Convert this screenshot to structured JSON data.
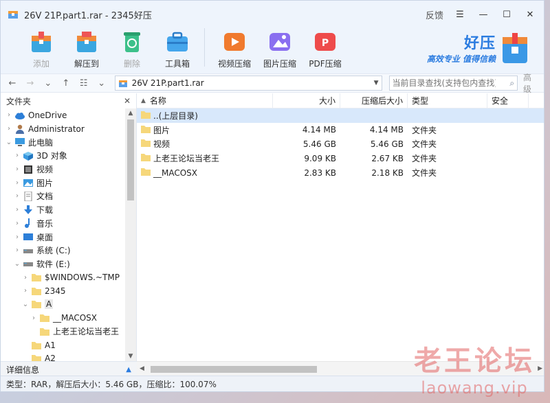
{
  "window": {
    "title": "26V 21P.part1.rar - 2345好压",
    "feedback": "反馈"
  },
  "toolbar": {
    "buttons": [
      {
        "label": "添加",
        "icon": "add-archive-icon",
        "enabled": false
      },
      {
        "label": "解压到",
        "icon": "extract-icon",
        "enabled": true
      },
      {
        "label": "删除",
        "icon": "recycle-icon",
        "enabled": false
      },
      {
        "label": "工具箱",
        "icon": "toolbox-icon",
        "enabled": true
      },
      {
        "label": "视频压缩",
        "icon": "video-compress-icon",
        "enabled": true
      },
      {
        "label": "图片压缩",
        "icon": "image-compress-icon",
        "enabled": true
      },
      {
        "label": "PDF压缩",
        "icon": "pdf-compress-icon",
        "enabled": true
      }
    ],
    "brand": {
      "name": "好压",
      "slogan": "高效专业 值得信赖"
    }
  },
  "addressbar": {
    "path": "26V 21P.part1.rar",
    "search_placeholder": "当前目录查找(支持包内查找)",
    "advanced": "高级"
  },
  "tree": {
    "header": "文件夹",
    "items": [
      {
        "label": "OneDrive",
        "depth": 0,
        "arrow": "›",
        "icon": "cloud-icon"
      },
      {
        "label": "Administrator",
        "depth": 0,
        "arrow": "›",
        "icon": "user-icon"
      },
      {
        "label": "此电脑",
        "depth": 0,
        "arrow": "⌄",
        "icon": "computer-icon"
      },
      {
        "label": "3D 对象",
        "depth": 1,
        "arrow": "›",
        "icon": "cube-icon"
      },
      {
        "label": "视频",
        "depth": 1,
        "arrow": "›",
        "icon": "video-folder-icon"
      },
      {
        "label": "图片",
        "depth": 1,
        "arrow": "›",
        "icon": "picture-folder-icon"
      },
      {
        "label": "文档",
        "depth": 1,
        "arrow": "›",
        "icon": "document-folder-icon"
      },
      {
        "label": "下载",
        "depth": 1,
        "arrow": "›",
        "icon": "download-icon"
      },
      {
        "label": "音乐",
        "depth": 1,
        "arrow": "›",
        "icon": "music-icon"
      },
      {
        "label": "桌面",
        "depth": 1,
        "arrow": "›",
        "icon": "desktop-icon"
      },
      {
        "label": "系统 (C:)",
        "depth": 1,
        "arrow": "›",
        "icon": "drive-icon"
      },
      {
        "label": "软件 (E:)",
        "depth": 1,
        "arrow": "⌄",
        "icon": "drive-icon"
      },
      {
        "label": "$WINDOWS.~TMP",
        "depth": 2,
        "arrow": "›",
        "icon": "folder-icon"
      },
      {
        "label": "2345",
        "depth": 2,
        "arrow": "›",
        "icon": "folder-icon"
      },
      {
        "label": "A",
        "depth": 2,
        "arrow": "⌄",
        "icon": "folder-icon",
        "selected": true
      },
      {
        "label": "__MACOSX",
        "depth": 3,
        "arrow": "›",
        "icon": "folder-icon"
      },
      {
        "label": "上老王论坛当老王",
        "depth": 3,
        "arrow": "",
        "icon": "folder-icon"
      },
      {
        "label": "A1",
        "depth": 2,
        "arrow": "",
        "icon": "folder-icon"
      },
      {
        "label": "A2",
        "depth": 2,
        "arrow": "",
        "icon": "folder-icon"
      }
    ],
    "detail_label": "详细信息"
  },
  "list": {
    "columns": {
      "name": "名称",
      "size": "大小",
      "packed": "压缩后大小",
      "type": "类型",
      "security": "安全"
    },
    "rows": [
      {
        "name": "..(上层目录)",
        "size": "",
        "packed": "",
        "type": "",
        "highlight": true
      },
      {
        "name": "图片",
        "size": "4.14 MB",
        "packed": "4.14 MB",
        "type": "文件夹"
      },
      {
        "name": "视频",
        "size": "5.46 GB",
        "packed": "5.46 GB",
        "type": "文件夹"
      },
      {
        "name": "上老王论坛当老王",
        "size": "9.09 KB",
        "packed": "2.67 KB",
        "type": "文件夹"
      },
      {
        "name": "__MACOSX",
        "size": "2.83 KB",
        "packed": "2.18 KB",
        "type": "文件夹"
      }
    ]
  },
  "status": {
    "text": "类型：RAR，解压后大小：5.46 GB，压缩比：100.07%"
  },
  "watermark": {
    "line1": "老王论坛",
    "line2": "laowang.vip"
  },
  "colors": {
    "accent": "#2b7ce0",
    "folder": "#f6d77a",
    "selection": "#d8e8fb"
  }
}
